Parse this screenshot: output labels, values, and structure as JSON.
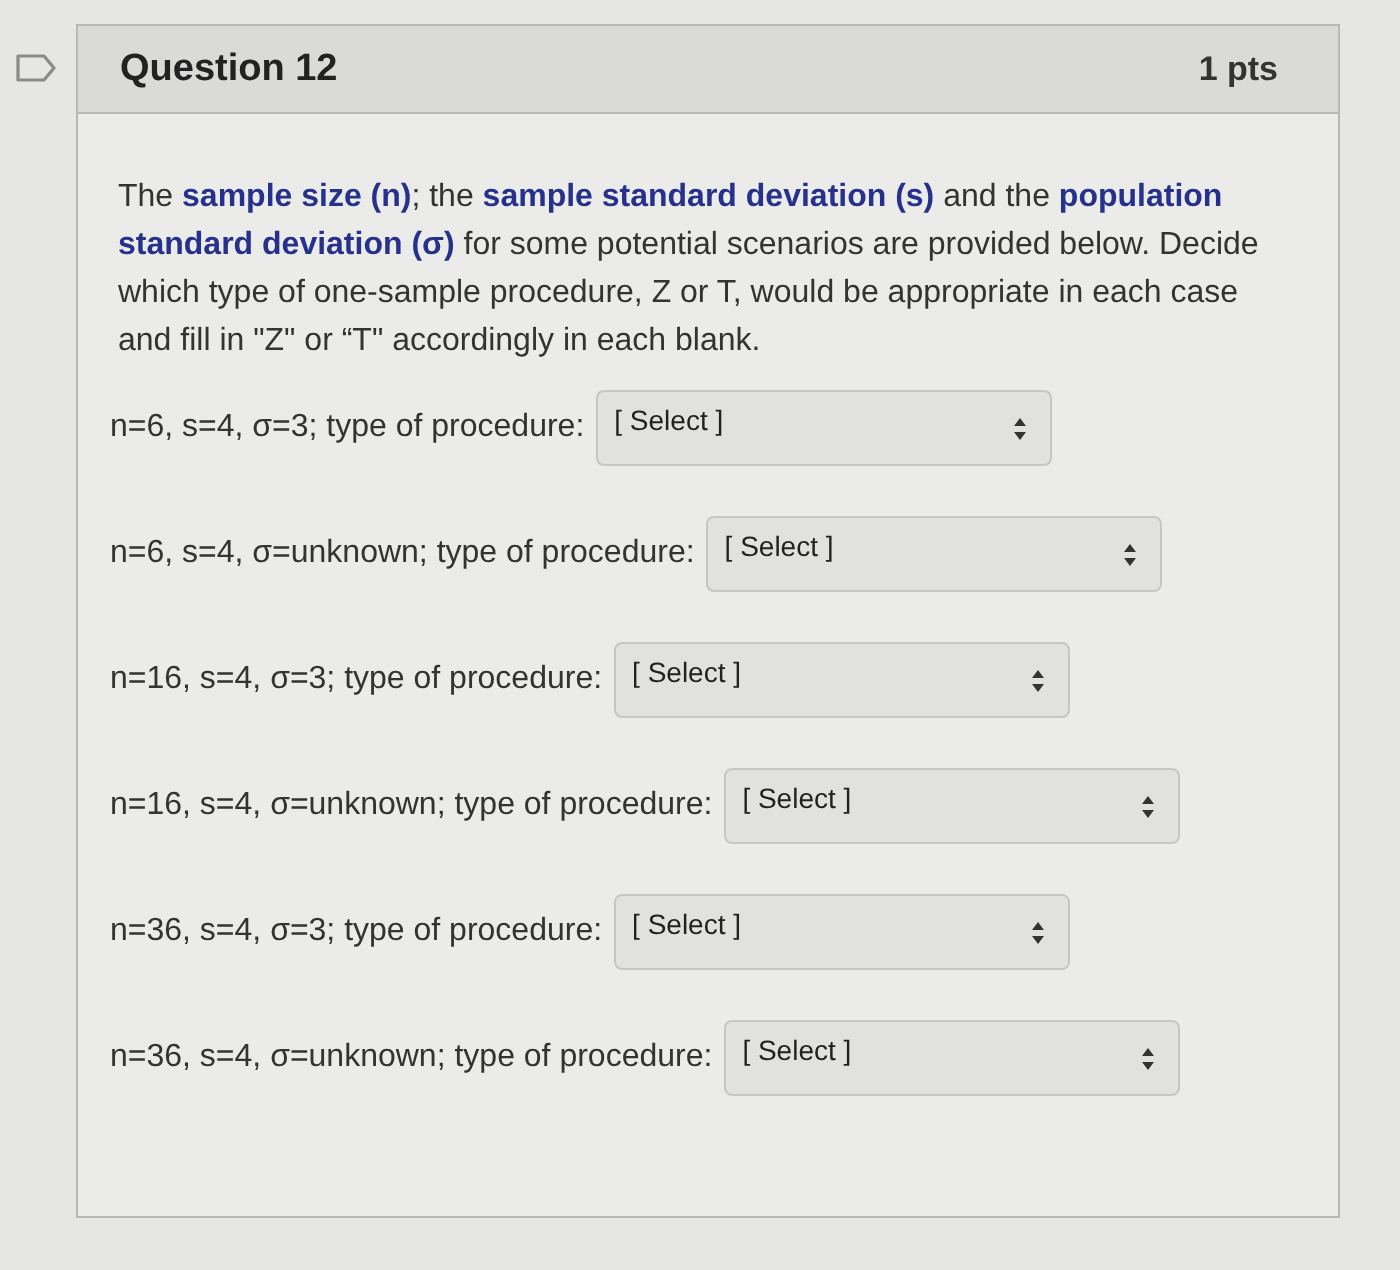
{
  "question": {
    "title": "Question 12",
    "points": "1 pts",
    "prompt": "The **sample size (n)**; the **sample standard deviation (s)** and the **population standard deviation (σ)** for some potential scenarios are provided below. Decide which type of one-sample procedure, Z or T, would be appropriate in each case and fill in \"Z\" or “T\" accordingly in each blank.",
    "items": [
      {
        "label": "n=6, s=4, σ=3; type of procedure:",
        "value": "[ Select ]"
      },
      {
        "label": "n=6, s=4, σ=unknown; type of procedure:",
        "value": "[ Select ]"
      },
      {
        "label": "n=16, s=4, σ=3; type of procedure:",
        "value": "[ Select ]"
      },
      {
        "label": "n=16, s=4, σ=unknown; type of procedure:",
        "value": "[ Select ]"
      },
      {
        "label": "n=36, s=4, σ=3; type of procedure:",
        "value": "[ Select ]"
      },
      {
        "label": "n=36, s=4, σ=unknown; type of procedure:",
        "value": "[ Select ]"
      }
    ]
  }
}
